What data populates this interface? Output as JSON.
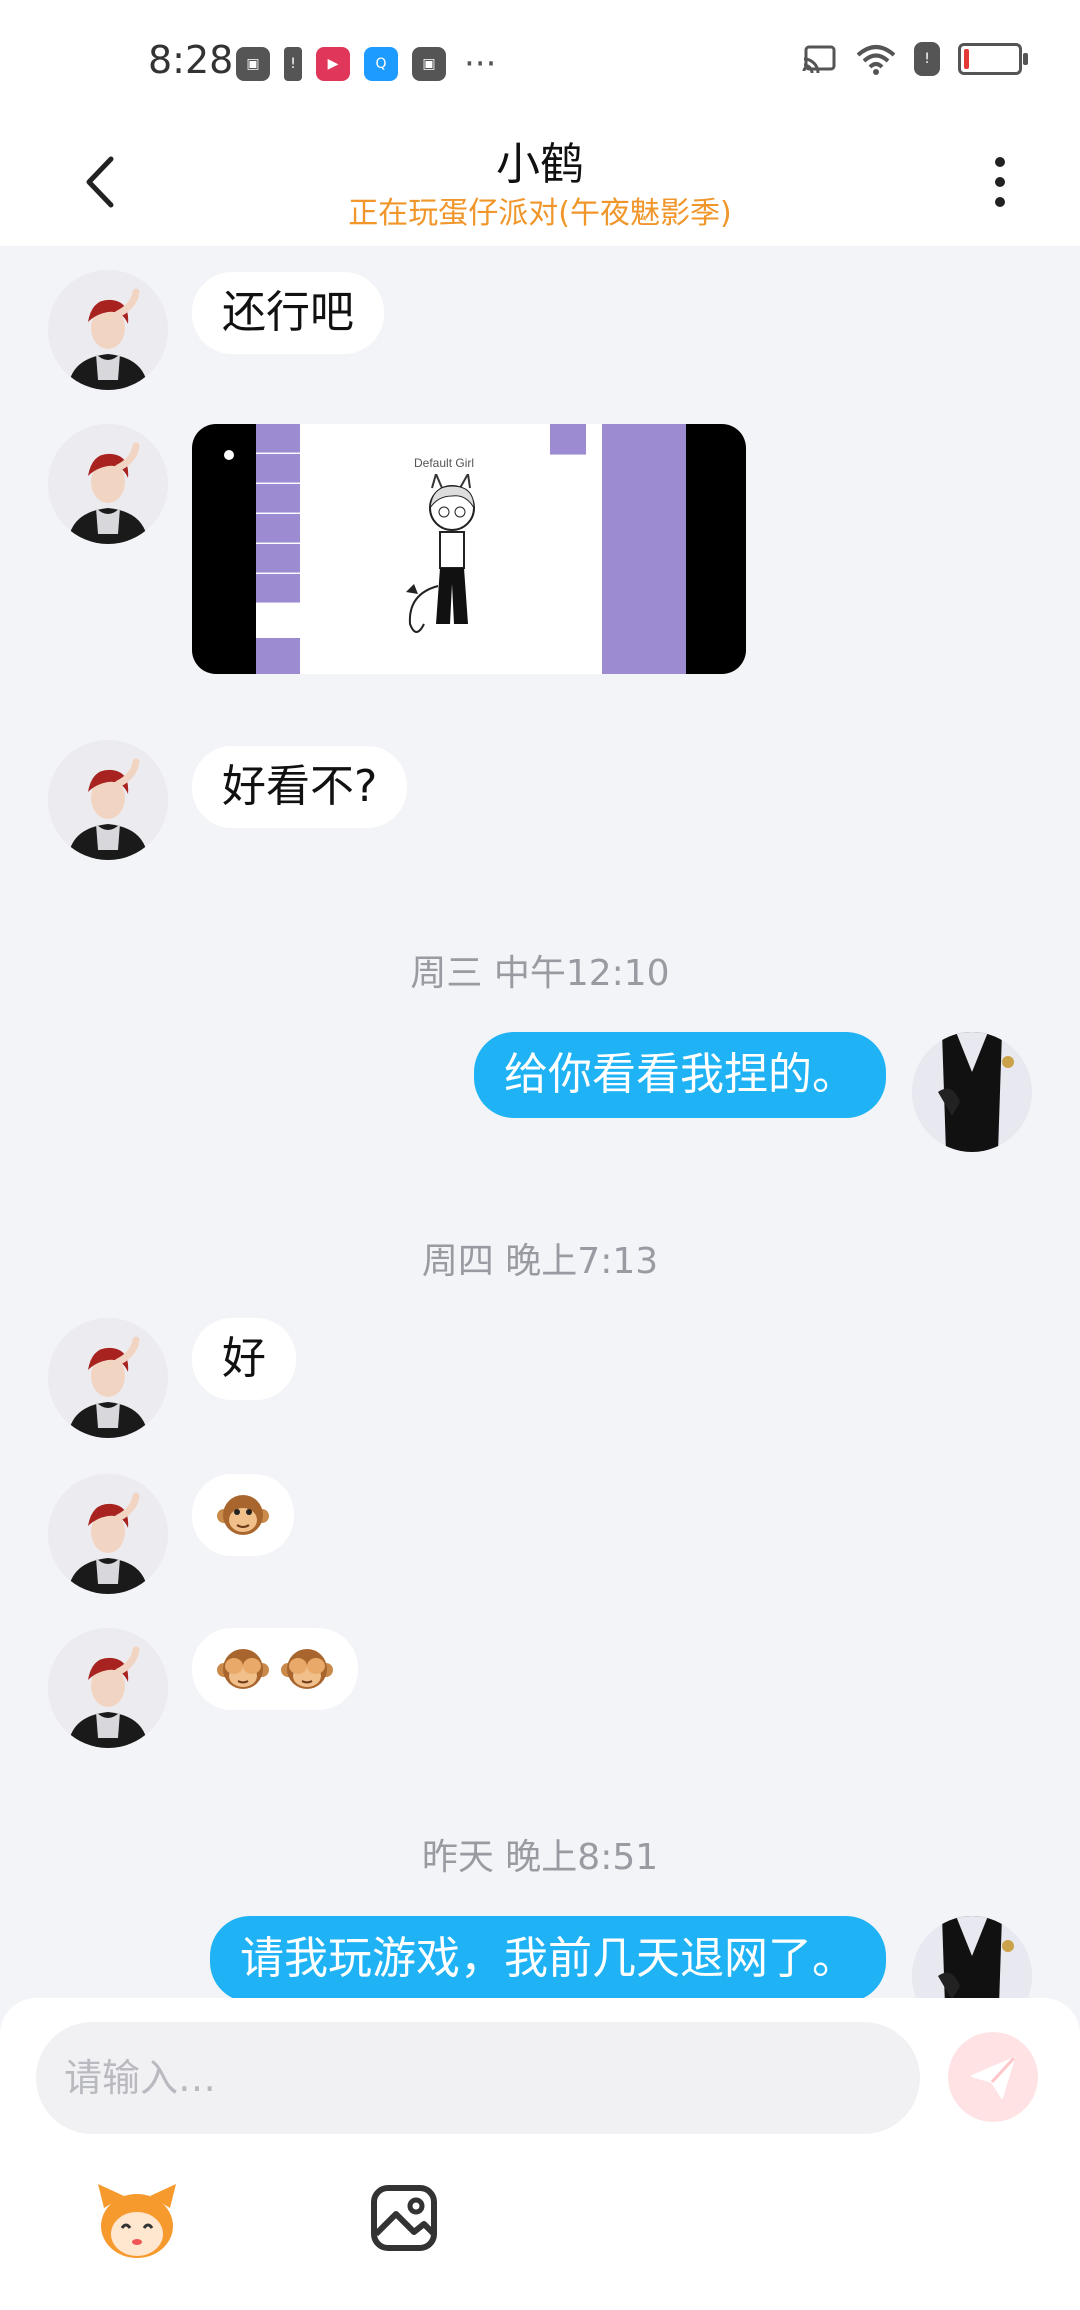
{
  "status_bar": {
    "time": "8:28",
    "left_icons": [
      "huawei-icon",
      "warning-icon",
      "video-app-icon",
      "search-app-icon",
      "huawei-icon"
    ],
    "dots": "···",
    "right_icons": [
      "cast-icon",
      "wifi-icon",
      "warning-icon",
      "battery-icon"
    ],
    "battery_level": 0.08
  },
  "header": {
    "name": "小鹤",
    "status": "正在玩蛋仔派对(午夜魅影季)"
  },
  "messages": [
    {
      "side": "left",
      "type": "text",
      "text": "还行吧"
    },
    {
      "side": "left",
      "type": "image",
      "image_text": "Default Girl"
    },
    {
      "side": "left",
      "type": "text",
      "text": "好看不?"
    },
    {
      "type": "timestamp",
      "text": "周三 中午12:10"
    },
    {
      "side": "right",
      "type": "text",
      "text": "给你看看我捏的。"
    },
    {
      "type": "timestamp",
      "text": "周四 晚上7:13"
    },
    {
      "side": "left",
      "type": "text",
      "text": "好"
    },
    {
      "side": "left",
      "type": "emoji",
      "emoji": "monkey-face-icon"
    },
    {
      "side": "left",
      "type": "emoji",
      "emoji": "see-no-evil-monkey-icon x2"
    },
    {
      "type": "timestamp",
      "text": "昨天 晚上8:51"
    },
    {
      "side": "right",
      "type": "text",
      "text": "请我玩游戏，我前几天退网了。"
    }
  ],
  "input": {
    "placeholder": "请输入…",
    "send_icon": "paper-plane-icon",
    "tools": [
      "mascot-icon",
      "image-icon"
    ]
  },
  "colors": {
    "accent_blue": "#1fb3f5",
    "status_orange": "#f0962a",
    "background": "#f3f4f7"
  }
}
